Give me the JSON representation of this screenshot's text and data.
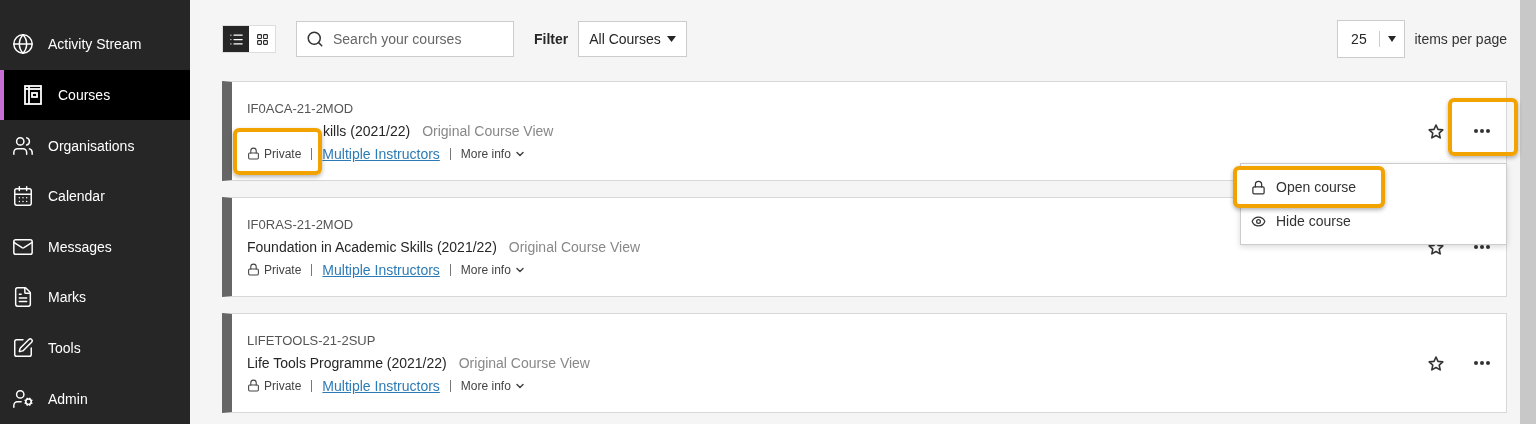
{
  "sidebar": {
    "items": [
      {
        "label": "Activity Stream",
        "selected": false
      },
      {
        "label": "Courses",
        "selected": true
      },
      {
        "label": "Organisations",
        "selected": false
      },
      {
        "label": "Calendar",
        "selected": false
      },
      {
        "label": "Messages",
        "selected": false
      },
      {
        "label": "Marks",
        "selected": false
      },
      {
        "label": "Tools",
        "selected": false
      },
      {
        "label": "Admin",
        "selected": false
      }
    ]
  },
  "toolbar": {
    "views": [
      {
        "kind": "list",
        "selected": true
      },
      {
        "kind": "grid",
        "selected": false
      }
    ],
    "search": {
      "placeholder": "Search your courses"
    },
    "filter": {
      "label": "Filter",
      "value": "All Courses"
    },
    "page_size": {
      "value": "25",
      "label": "items per page"
    }
  },
  "courses": [
    {
      "code": "IF0ACA-21-2MOD",
      "title": "kills (2021/22)",
      "view": "Original Course View",
      "privacy": "Private",
      "privacy_highlighted": true,
      "instructors": "Multiple Instructors",
      "more": "More info",
      "menu_highlighted": true,
      "menu": [
        {
          "label": "Open course",
          "highlighted": true
        },
        {
          "label": "Hide course",
          "highlighted": false
        }
      ]
    },
    {
      "code": "IF0RAS-21-2MOD",
      "title": "Foundation in Academic Skills (2021/22)",
      "view": "Original Course View",
      "privacy": "Private",
      "privacy_highlighted": false,
      "instructors": "Multiple Instructors",
      "more": "More info",
      "menu_highlighted": false
    },
    {
      "code": "LIFETOOLS-21-2SUP",
      "title": "Life Tools Programme (2021/22)",
      "view": "Original Course View",
      "privacy": "Private",
      "privacy_highlighted": false,
      "instructors": "Multiple Instructors",
      "more": "More info",
      "menu_highlighted": false
    }
  ]
}
